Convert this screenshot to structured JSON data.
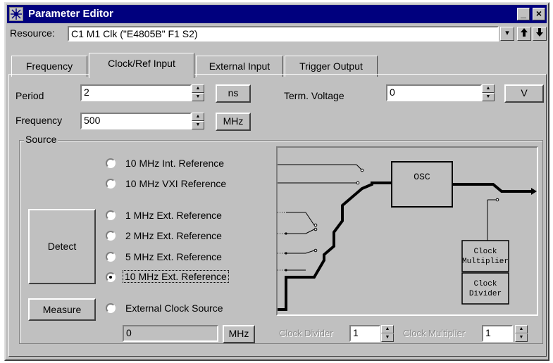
{
  "window": {
    "title": "Parameter Editor",
    "minimize_label": "_",
    "close_label": "×"
  },
  "resource": {
    "label": "Resource:",
    "value": "C1 M1 Clk (\"E4805B\" F1 S2)",
    "dropdown_glyph": "▾",
    "up_glyph": "🡅",
    "down_glyph": "🡇"
  },
  "tabs": [
    {
      "label": "Frequency",
      "active": false
    },
    {
      "label": "Clock/Ref Input",
      "active": true
    },
    {
      "label": "External Input",
      "active": false
    },
    {
      "label": "Trigger Output",
      "active": false
    }
  ],
  "period": {
    "label": "Period",
    "value": "2",
    "unit": "ns"
  },
  "frequency": {
    "label": "Frequency",
    "value": "500",
    "unit": "MHz"
  },
  "term_voltage": {
    "label": "Term. Voltage",
    "value": "0",
    "unit": "V"
  },
  "source": {
    "title": "Source",
    "options": [
      {
        "label": "10 MHz Int. Reference",
        "checked": false
      },
      {
        "label": "10 MHz VXI Reference",
        "checked": false
      },
      {
        "label": "1 MHz Ext. Reference",
        "checked": false
      },
      {
        "label": "2 MHz Ext. Reference",
        "checked": false
      },
      {
        "label": "5 MHz Ext. Reference",
        "checked": false
      },
      {
        "label": "10 MHz Ext. Reference",
        "checked": true
      },
      {
        "label": "External Clock Source",
        "checked": false
      }
    ],
    "detect_label": "Detect",
    "measure_label": "Measure",
    "measure_value": "0",
    "measure_unit": "MHz"
  },
  "diagram": {
    "osc_label": "OSC",
    "multiplier_label_1": "Clock",
    "multiplier_label_2": "Multiplier",
    "divider_label_1": "Clock",
    "divider_label_2": "Divider"
  },
  "clock_divider": {
    "label": "Clock Divider",
    "value": "1"
  },
  "clock_multiplier": {
    "label": "Clock Multiplier",
    "value": "1"
  }
}
